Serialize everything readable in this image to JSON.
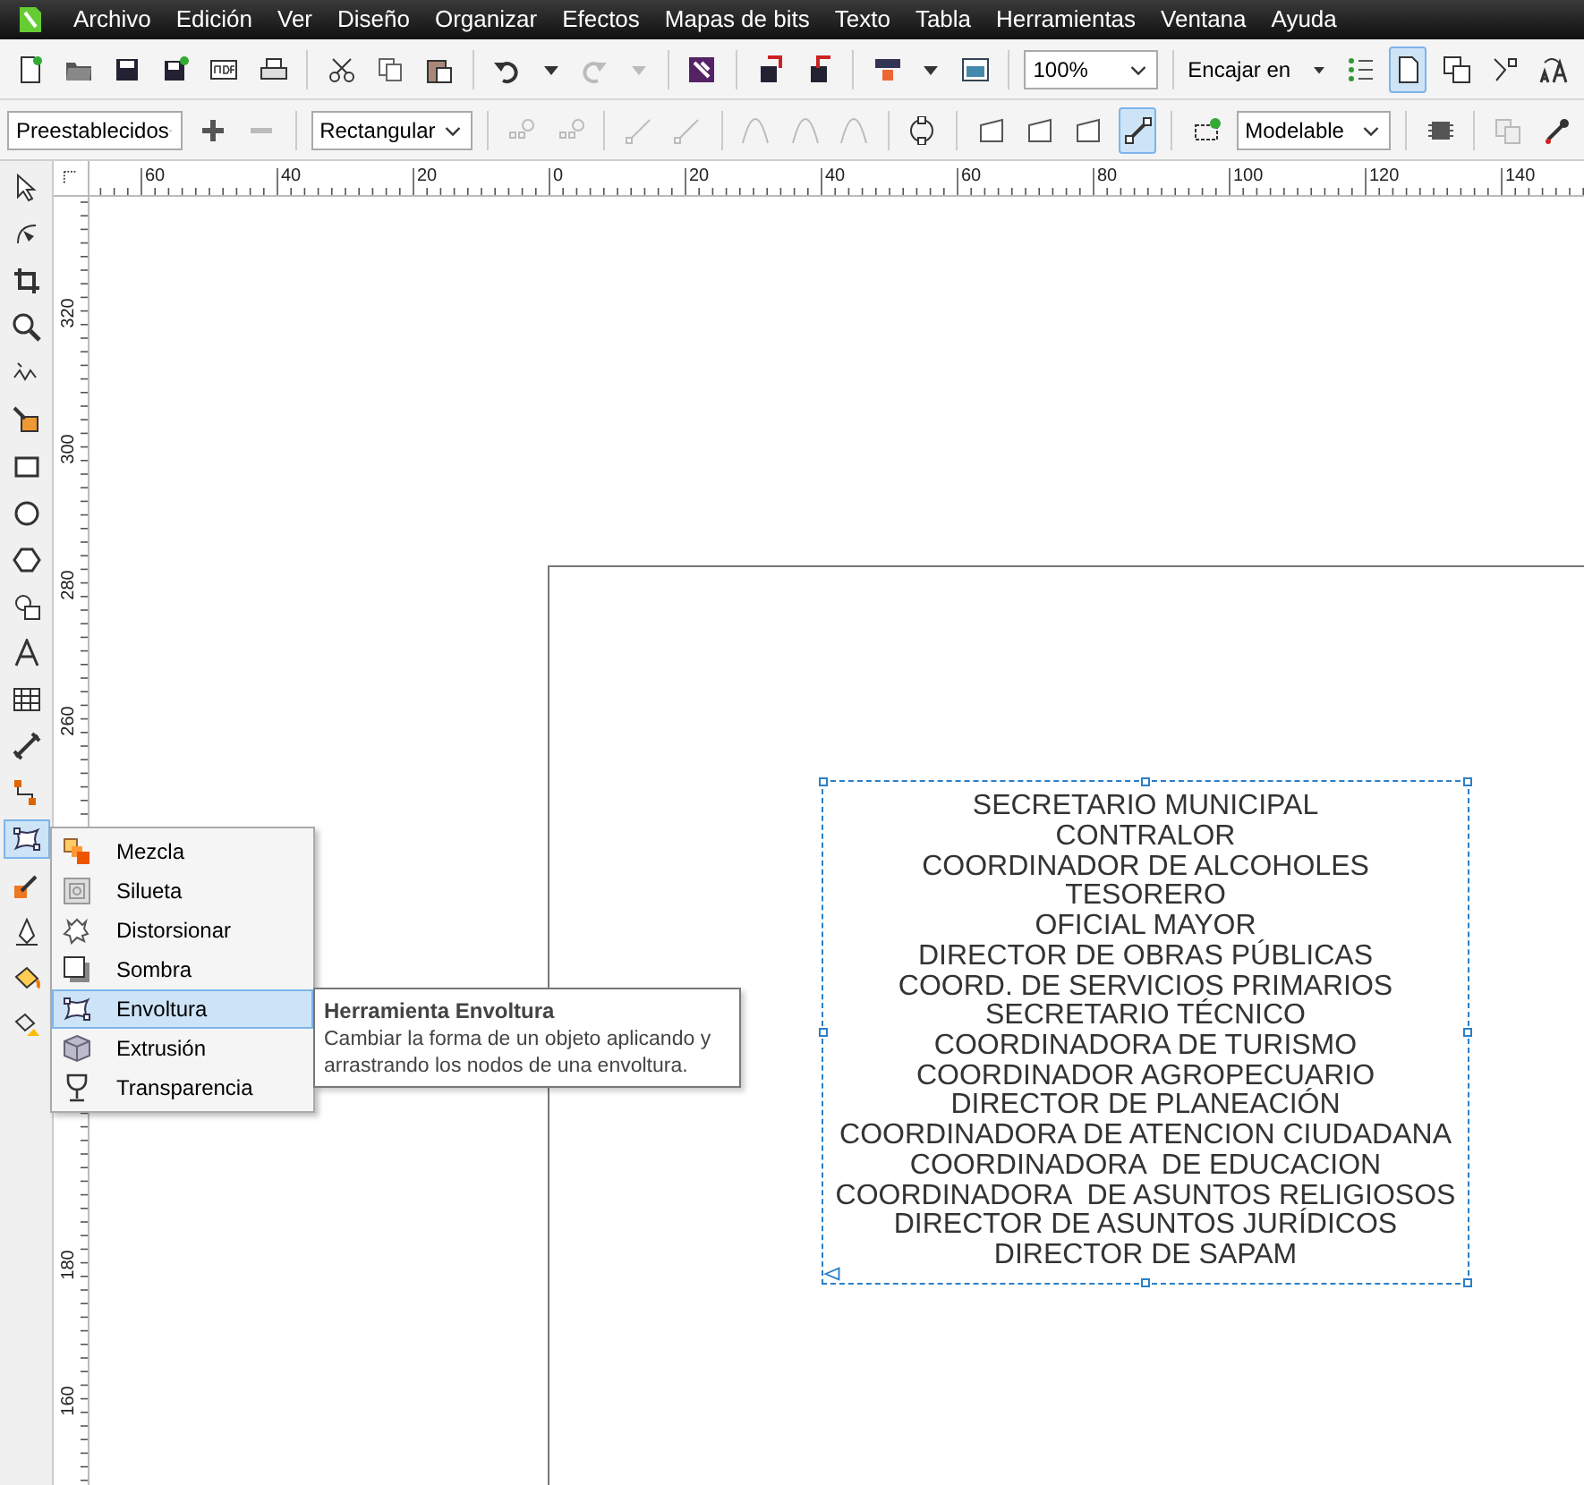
{
  "menu": [
    "Archivo",
    "Edición",
    "Ver",
    "Diseño",
    "Organizar",
    "Efectos",
    "Mapas de bits",
    "Texto",
    "Tabla",
    "Herramientas",
    "Ventana",
    "Ayuda"
  ],
  "toolbar_standard": {
    "zoom": "100%",
    "snap_label": "Encajar en",
    "toggles": [
      {
        "selected": true
      },
      {
        "selected": false
      },
      {
        "selected": false
      },
      {
        "selected": false
      }
    ]
  },
  "property_bar": {
    "preset": "Preestablecidos",
    "mode": "Rectangular",
    "envelope_mode": "Modelable",
    "shape_buttons": [
      {
        "selected": false
      },
      {
        "selected": false
      },
      {
        "selected": false
      },
      {
        "selected": true
      }
    ]
  },
  "ruler_horizontal": [
    "60",
    "40",
    "20",
    "0",
    "20",
    "40",
    "60",
    "80",
    "100",
    "120",
    "140"
  ],
  "ruler_vertical": {
    "upper": [
      "320",
      "300",
      "280",
      "260"
    ],
    "lower": [
      "180",
      "160"
    ]
  },
  "toolbox": [
    {
      "selected": false
    },
    {
      "selected": false
    },
    {
      "selected": false
    },
    {
      "selected": false
    },
    {
      "selected": false
    },
    {
      "selected": false
    },
    {
      "selected": false
    },
    {
      "selected": false
    },
    {
      "selected": false
    },
    {
      "selected": false
    },
    {
      "selected": false
    },
    {
      "selected": false
    },
    {
      "selected": false
    },
    {
      "selected": false
    },
    {
      "selected": true
    },
    {
      "selected": false
    },
    {
      "selected": false
    },
    {
      "selected": false
    },
    {
      "selected": false
    }
  ],
  "flyout": [
    {
      "label": "Mezcla",
      "selected": false
    },
    {
      "label": "Silueta",
      "selected": false
    },
    {
      "label": "Distorsionar",
      "selected": false
    },
    {
      "label": "Sombra",
      "selected": false
    },
    {
      "label": "Envoltura",
      "selected": true
    },
    {
      "label": "Extrusión",
      "selected": false
    },
    {
      "label": "Transparencia",
      "selected": false
    }
  ],
  "tooltip": {
    "title": "Herramienta Envoltura",
    "description": "Cambiar la forma de un objeto aplicando y arrastrando los nodos de una envoltura."
  },
  "canvas_text": [
    "SECRETARIO MUNICIPAL",
    "CONTRALOR",
    "COORDINADOR DE ALCOHOLES",
    "TESORERO",
    "OFICIAL MAYOR",
    "DIRECTOR DE OBRAS PÚBLICAS",
    "COORD. DE SERVICIOS PRIMARIOS",
    "SECRETARIO TÉCNICO",
    "COORDINADORA DE TURISMO",
    "COORDINADOR AGROPECUARIO",
    "DIRECTOR DE PLANEACIÓN",
    "COORDINADORA DE ATENCION CIUDADANA",
    "COORDINADORA  DE EDUCACION",
    "COORDINADORA  DE ASUNTOS RELIGIOSOS",
    "DIRECTOR DE ASUNTOS JURÍDICOS",
    "DIRECTOR DE SAPAM"
  ]
}
